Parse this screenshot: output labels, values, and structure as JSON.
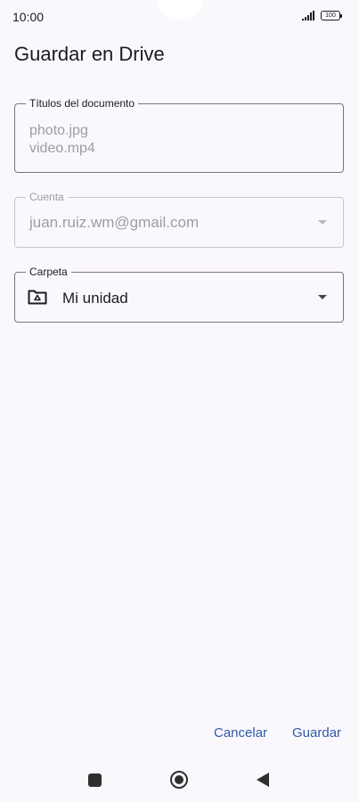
{
  "status_bar": {
    "time": "10:00",
    "battery": "100"
  },
  "header": {
    "title": "Guardar en Drive"
  },
  "document_field": {
    "label": "Títulos del documento",
    "lines": [
      "photo.jpg",
      "video.mp4"
    ]
  },
  "account_field": {
    "label": "Cuenta",
    "value": "juan.ruiz.wm@gmail.com"
  },
  "folder_field": {
    "label": "Carpeta",
    "value": "Mi unidad"
  },
  "actions": {
    "cancel": "Cancelar",
    "save": "Guardar"
  },
  "colors": {
    "background": "#fbf8fd",
    "accent": "#2f5aa8",
    "outline": "#79757f",
    "disabled_text": "#9e9ba2"
  },
  "icons": {
    "folder": "shared-drive-folder-icon",
    "dropdown": "caret-down-icon",
    "home": "home-circle-icon",
    "recents": "square-recents-icon",
    "back": "triangle-back-icon",
    "signal": "signal-bars-icon",
    "battery": "battery-icon"
  }
}
